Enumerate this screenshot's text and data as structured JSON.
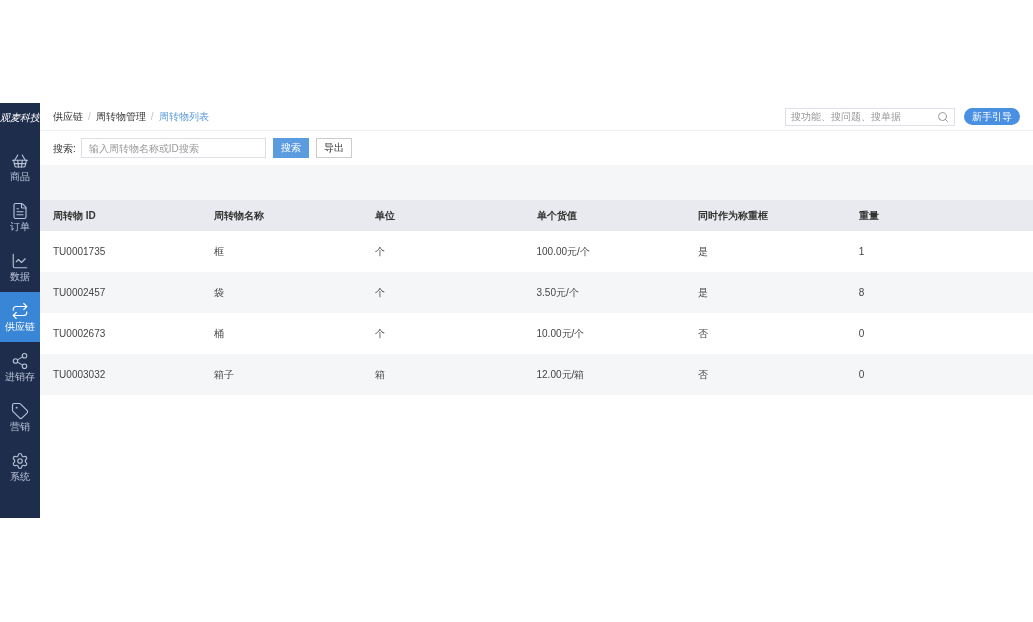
{
  "sidebar": {
    "brand": "观麦科技",
    "items": [
      {
        "kind": "basket",
        "label": "商品",
        "selected": false
      },
      {
        "kind": "document",
        "label": "订单",
        "selected": false
      },
      {
        "kind": "chart",
        "label": "数据",
        "selected": false
      },
      {
        "kind": "arrows",
        "label": "供应链",
        "selected": true
      },
      {
        "kind": "nodes",
        "label": "进销存",
        "selected": false
      },
      {
        "kind": "tag",
        "label": "营销",
        "selected": false
      },
      {
        "kind": "gear",
        "label": "系统",
        "selected": false
      }
    ]
  },
  "breadcrumb": {
    "separator": "/",
    "items": [
      "供应链",
      "周转物管理",
      "周转物列表"
    ]
  },
  "global_search": {
    "placeholder": "搜功能、搜问题、搜单据"
  },
  "guide_button": "新手引导",
  "filter": {
    "label": "搜索:",
    "placeholder": "输入周转物名称或ID搜索",
    "search_button": "搜索",
    "export_button": "导出"
  },
  "table": {
    "columns": [
      "周转物 ID",
      "周转物名称",
      "单位",
      "单个货值",
      "同时作为称重框",
      "重量"
    ],
    "rows": [
      [
        "TU0001735",
        "框",
        "个",
        "100.00元/个",
        "是",
        "1"
      ],
      [
        "TU0002457",
        "袋",
        "个",
        "3.50元/个",
        "是",
        "8"
      ],
      [
        "TU0002673",
        "桶",
        "个",
        "10.00元/个",
        "否",
        "0"
      ],
      [
        "TU0003032",
        "箱子",
        "箱",
        "12.00元/箱",
        "否",
        "0"
      ]
    ]
  }
}
